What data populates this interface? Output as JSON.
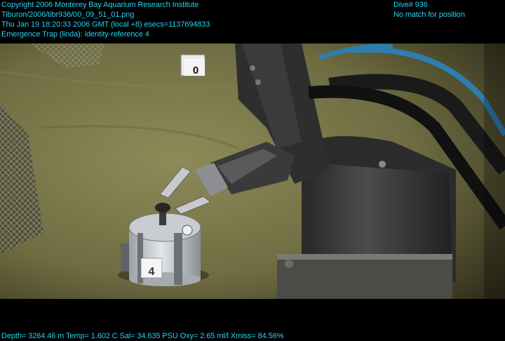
{
  "overlay": {
    "top_left": [
      "Copyright 2006 Monterey Bay Aquarium Research Institute",
      "Tiburon/2006/tibr936/00_09_51_01.png",
      "Thu Jan 19 18:20:33 2006 GMT (local +8)  esecs=1137694833",
      "Emergence Trap (linda): identity-reference 4"
    ],
    "top_right": [
      "Dive# 936",
      "No match for position"
    ],
    "bottom": "Depth= 3264.46 m  Temp= 1.602 C  Sal= 34.635 PSU  Oxy= 2.65 ml/l  Xmiss= 84.56%"
  },
  "scene": {
    "marker_left_number": "0",
    "trap_number": "4",
    "overlay_color": "#22d3f0",
    "seafloor_color": "#7d7a4f",
    "icon": "underwater-rov-manipulator-arm"
  }
}
